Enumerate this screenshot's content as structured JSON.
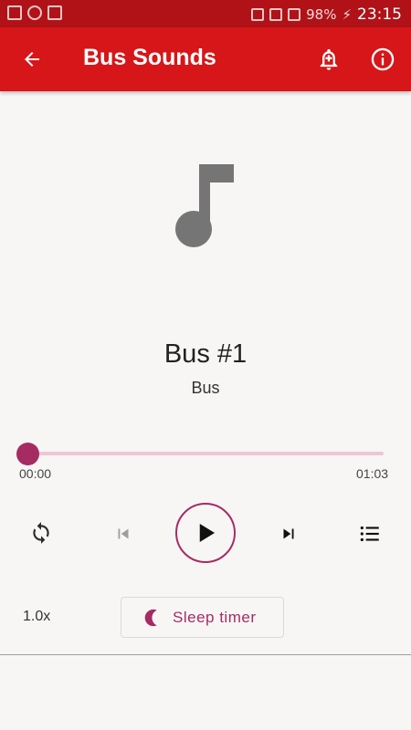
{
  "status_bar": {
    "battery": "98%",
    "time": "23:15"
  },
  "app_bar": {
    "title": "Bus Sounds",
    "back_icon": "arrow-back-icon",
    "alarm_icon": "add-alarm-icon",
    "info_icon": "info-icon"
  },
  "track": {
    "title": "Bus #1",
    "artist": "Bus"
  },
  "progress": {
    "current": "00:00",
    "total": "01:03",
    "fraction": 0.0
  },
  "controls": {
    "repeat_icon": "repeat-icon",
    "previous_icon": "skip-previous-icon",
    "play_icon": "play-icon",
    "next_icon": "skip-next-icon",
    "playlist_icon": "playlist-icon"
  },
  "footer": {
    "speed": "1.0x",
    "sleep_timer_label": "Sleep timer",
    "sleep_icon": "moon-icon"
  },
  "colors": {
    "app_bar": "#d61618",
    "status_bar": "#b01217",
    "accent": "#a62b63",
    "track_bg": "#ecc7d6",
    "background": "#f7f6f5"
  }
}
